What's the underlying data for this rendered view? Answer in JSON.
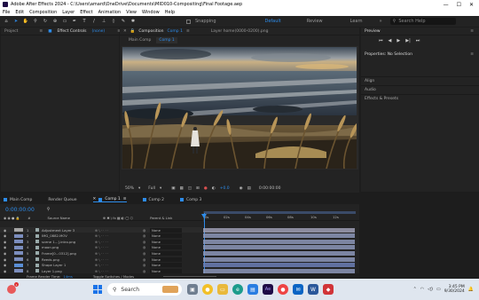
{
  "titlebar": {
    "title": "Adobe After Effects 2024 - C:\\Users\\amard\\OneDrive\\Documents\\MID010-Compositing\\Final Footage.aep",
    "min": "—",
    "max": "☐",
    "close": "✕"
  },
  "menu": [
    "File",
    "Edit",
    "Composition",
    "Layer",
    "Effect",
    "Animation",
    "View",
    "Window",
    "Help"
  ],
  "toolbar": {
    "snapping": "Snapping",
    "workspaces": [
      "Default",
      "Review",
      "Learn"
    ],
    "search_placeholder": "Search Help"
  },
  "panels": {
    "project": "Project",
    "effect_controls": "Effect Controls",
    "effect_controls_target": "(none)",
    "composition": "Composition",
    "comp_name": "Comp 1",
    "layer_tab": "Layer  home(0000-0200).png",
    "viewer_tabs": [
      "Main Comp",
      "Comp 1"
    ],
    "preview": "Preview",
    "properties": "Properties: No Selection",
    "align": "Align",
    "audio": "Audio",
    "effects": "Effects & Presets"
  },
  "viewer_bar": {
    "zoom": "50%",
    "resolution": "Full",
    "exposure": "+0.0",
    "time": "0:00:00:00"
  },
  "timeline": {
    "tabs": [
      "Main Comp",
      "Render Queue",
      "Comp 1",
      "Comp 2",
      "Comp 3"
    ],
    "timecode": "0:00:00:00",
    "col_source": "Source Name",
    "col_parent": "Parent & Link",
    "ruler": [
      "0s",
      "02s",
      "04s",
      "06s",
      "08s",
      "10s",
      "12s"
    ],
    "layers": [
      {
        "num": "1",
        "name": "Adjustment Layer 3",
        "parent": "None",
        "color": "#a7a7a7"
      },
      {
        "num": "2",
        "name": "IMG_0882.MOV",
        "parent": "None",
        "color": "#7b8dbd"
      },
      {
        "num": "3",
        "name": "scene 1...].intro.png",
        "parent": "None",
        "color": "#7b8dbd"
      },
      {
        "num": "4",
        "name": "moon.png",
        "parent": "None",
        "color": "#7b8dbd"
      },
      {
        "num": "5",
        "name": "Frame[0...0312].png",
        "parent": "None",
        "color": "#7b8dbd"
      },
      {
        "num": "6",
        "name": "Reeds.png",
        "parent": "None",
        "color": "#7b8dbd"
      },
      {
        "num": "7",
        "name": "Shape Layer 1",
        "parent": "None",
        "color": "#5a8fd6"
      },
      {
        "num": "8",
        "name": "Layer 1.png",
        "parent": "None",
        "color": "#7b8dbd"
      }
    ],
    "footer_left": "Frame Render Time:",
    "footer_time": "14ms",
    "footer_toggle": "Toggle Switches / Modes"
  },
  "taskbar": {
    "search": "Search",
    "time": "3:45 PM",
    "date": "9/30/2024"
  },
  "colors": {
    "accent": "#2d8ceb",
    "ae": "#1f0c46"
  }
}
